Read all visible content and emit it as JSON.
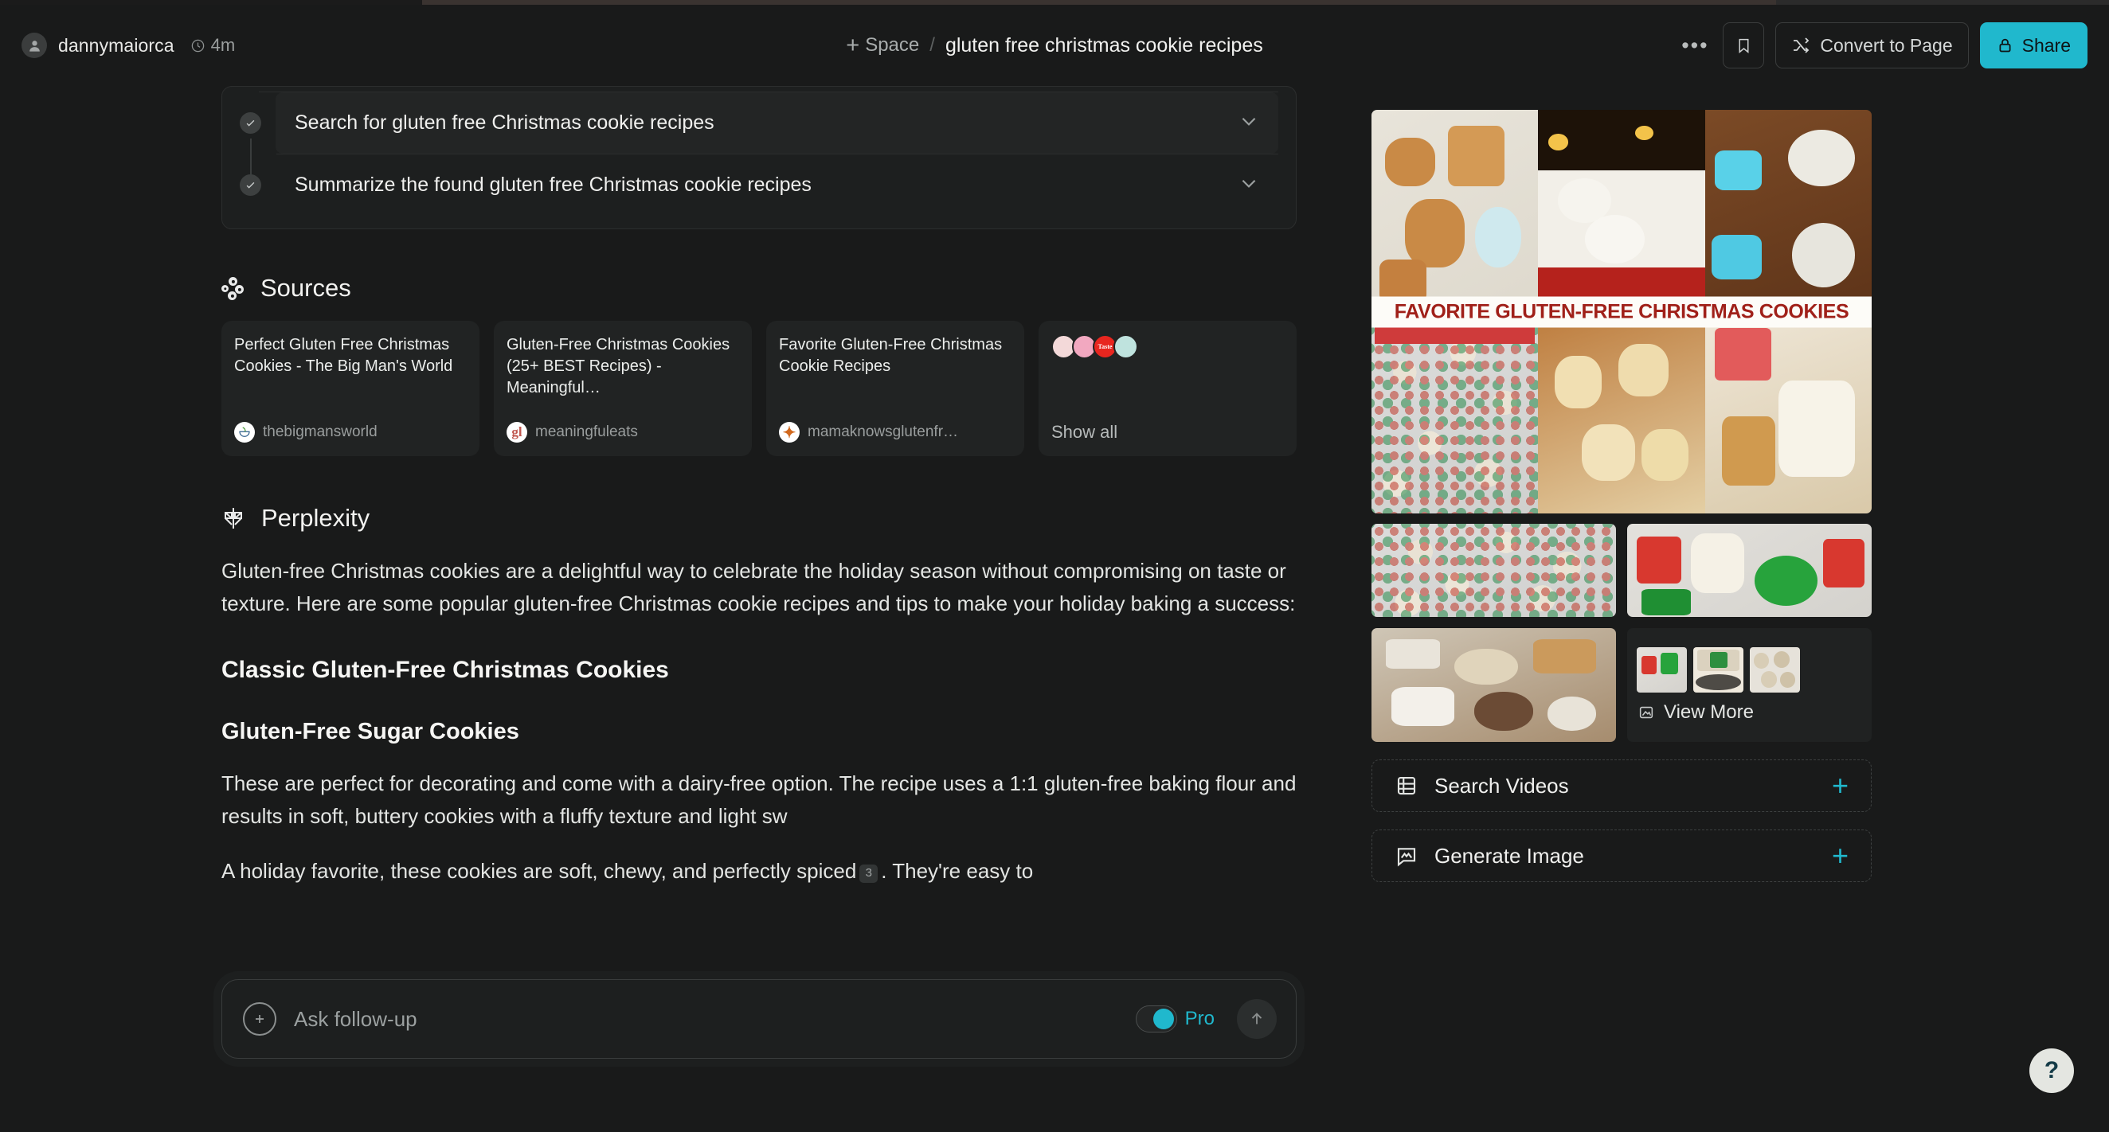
{
  "app": {
    "accent": "#20b8cd",
    "background": "#191a1a"
  },
  "topbar": {
    "username": "dannymaiorca",
    "time_ago": "4m",
    "space_label": "Space",
    "breadcrumb_separator": "/",
    "thread_title": "gluten free christmas cookie recipes",
    "more_label": "•••",
    "convert_label": "Convert to Page",
    "share_label": "Share"
  },
  "tasks": [
    {
      "label": "Search for gluten free Christmas cookie recipes",
      "checked": true,
      "expanded": false
    },
    {
      "label": "Summarize the found gluten free Christmas cookie recipes",
      "checked": true,
      "expanded": false
    }
  ],
  "sources": {
    "heading": "Sources",
    "cards": [
      {
        "title": "Perfect Gluten Free Christmas Cookies - The Big Man's World",
        "domain": "thebigmansworld",
        "favicon_letter": "",
        "favicon_bg": "#ffffff",
        "favicon_fg": "#3b7a3b"
      },
      {
        "title": "Gluten-Free Christmas Cookies (25+ BEST Recipes) - Meaningful…",
        "domain": "meaningfuleats",
        "favicon_letter": "gl",
        "favicon_bg": "#ffffff",
        "favicon_fg": "#c0564e"
      },
      {
        "title": "Favorite Gluten-Free Christmas Cookie Recipes",
        "domain": "mamaknowsglutenfr…",
        "favicon_letter": "✦",
        "favicon_bg": "#ffffff",
        "favicon_fg": "#d2691e"
      }
    ],
    "show_all_label": "Show all",
    "avatar_stack": [
      {
        "label": "",
        "bg": "#f3d9d9"
      },
      {
        "label": "",
        "bg": "#f2a8c0"
      },
      {
        "label": "Taste of Home",
        "bg": "#e8261f"
      },
      {
        "label": "",
        "bg": "#bfe3de"
      }
    ]
  },
  "answer": {
    "brand": "Perplexity",
    "intro": "Gluten-free Christmas cookies are a delightful way to celebrate the holiday season without compromising on taste or texture. Here are some popular gluten-free Christmas cookie recipes and tips to make your holiday baking a success:",
    "h2": "Classic Gluten-Free Christmas Cookies",
    "h3": "Gluten-Free Sugar Cookies",
    "body1_before": "These are perfect for decorating and come with a dairy-free option. The recipe uses a 1:1 gluten-free baking flour and results in soft, buttery cookies with a fluffy texture and light sw",
    "occluded_hint_1": "sw",
    "occluded_hint_2": "C",
    "body2_before": "A holiday favorite, these cookies are soft, chewy, and perfectly spiced",
    "body2_cite": "3",
    "body2_after": ". They're easy to"
  },
  "followup": {
    "placeholder": "Ask follow-up",
    "mode_label": "Pro",
    "mode_on": true,
    "add_icon": "plus-circle-icon",
    "send_icon": "arrow-up-icon"
  },
  "rail": {
    "hero_banner_text": "FAVORITE GLUTEN-FREE CHRISTMAS COOKIES",
    "view_more_label": "View More",
    "actions": [
      {
        "label": "Search Videos",
        "icon": "film-icon",
        "plus": "+"
      },
      {
        "label": "Generate Image",
        "icon": "image-message-icon",
        "plus": "+"
      }
    ]
  },
  "help": {
    "label": "?"
  }
}
